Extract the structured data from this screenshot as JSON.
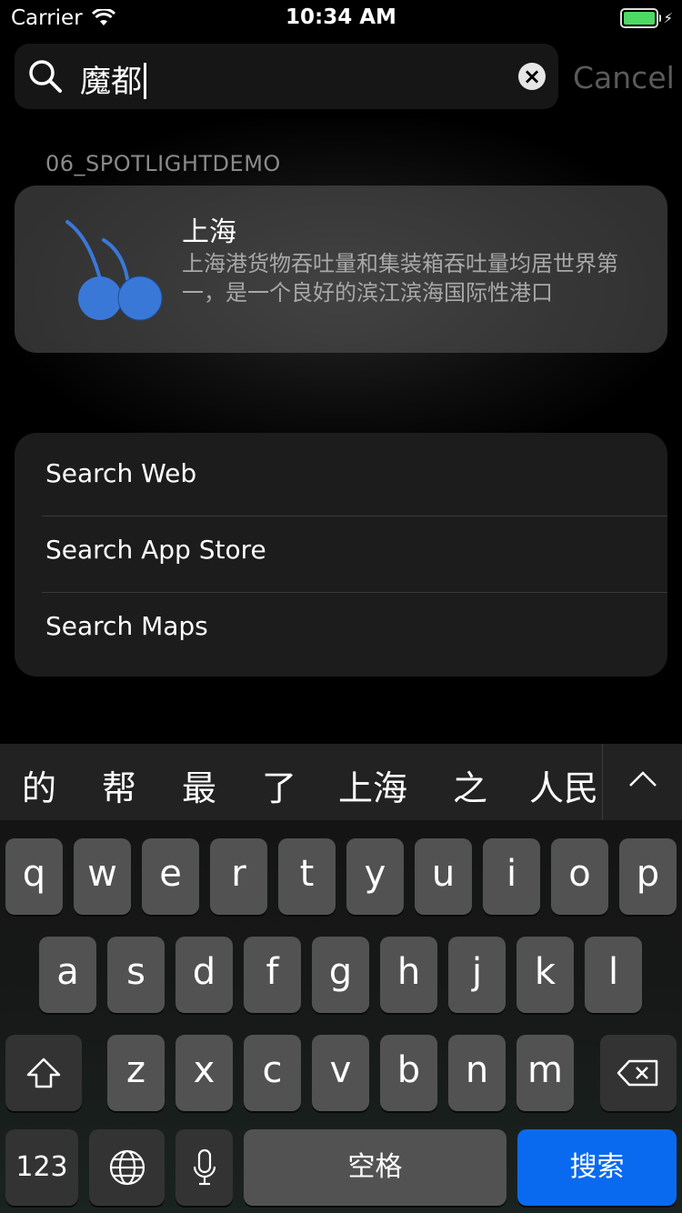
{
  "status_bar": {
    "carrier": "Carrier",
    "time": "10:34 AM"
  },
  "search": {
    "query": "魔都",
    "cancel_label": "Cancel"
  },
  "section": {
    "title": "06_SPOTLIGHTDEMO"
  },
  "result": {
    "title": "上海",
    "description": "上海港货物吞吐量和集装箱吞吐量均居世界第一，是一个良好的滨江滨海国际性港口",
    "icon": "cherry-icon"
  },
  "options": [
    {
      "label": "Search Web"
    },
    {
      "label": "Search App Store"
    },
    {
      "label": "Search Maps"
    }
  ],
  "keyboard": {
    "candidates": [
      "的",
      "帮",
      "最",
      "了",
      "上海",
      "之",
      "人民"
    ],
    "row1": [
      "q",
      "w",
      "e",
      "r",
      "t",
      "y",
      "u",
      "i",
      "o",
      "p"
    ],
    "row2": [
      "a",
      "s",
      "d",
      "f",
      "g",
      "h",
      "j",
      "k",
      "l"
    ],
    "row3": [
      "z",
      "x",
      "c",
      "v",
      "b",
      "n",
      "m"
    ],
    "num_label": "123",
    "space_label": "空格",
    "search_label": "搜索"
  },
  "colors": {
    "accent": "#0a6aef",
    "battery": "#4cd964",
    "cherry": "#3a78d8"
  }
}
